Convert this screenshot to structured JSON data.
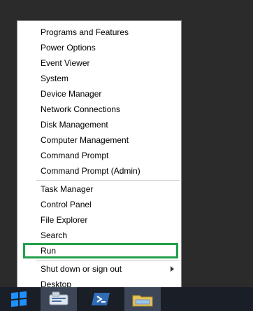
{
  "menu": {
    "group1": [
      "Programs and Features",
      "Power Options",
      "Event Viewer",
      "System",
      "Device Manager",
      "Network Connections",
      "Disk Management",
      "Computer Management",
      "Command Prompt",
      "Command Prompt (Admin)"
    ],
    "group2": [
      "Task Manager",
      "Control Panel",
      "File Explorer",
      "Search",
      "Run"
    ],
    "group3": [
      "Shut down or sign out",
      "Desktop"
    ]
  },
  "highlight": {
    "item": "Run",
    "color": "#21a04a"
  },
  "taskbar": {
    "icons": [
      "windows-start-icon",
      "server-manager-icon",
      "powershell-icon",
      "file-explorer-icon"
    ],
    "accent": "#1e90ff"
  }
}
